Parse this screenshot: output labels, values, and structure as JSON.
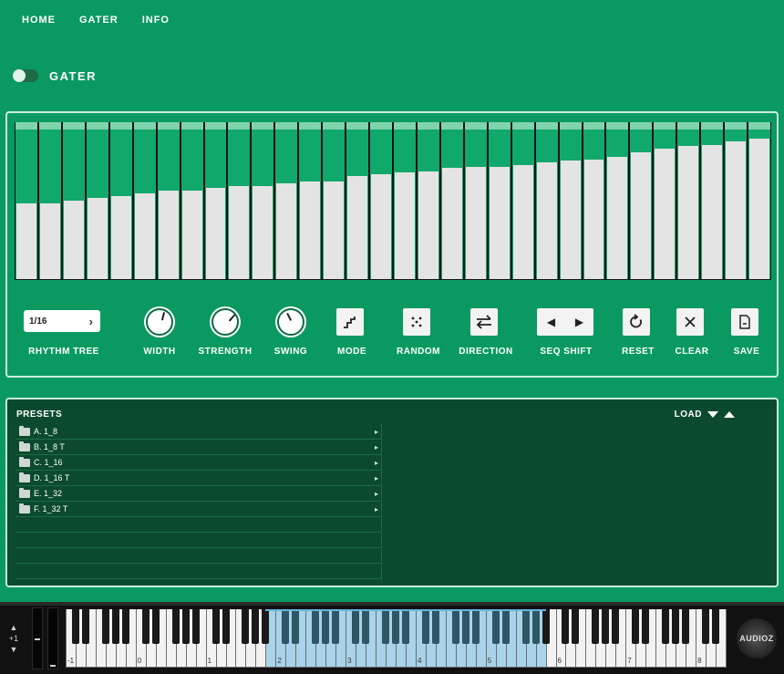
{
  "nav": [
    "HOME",
    "GATER",
    "INFO"
  ],
  "module": {
    "title": "GATER",
    "enabled": false
  },
  "sequencer": {
    "step_levels": [
      0.51,
      0.51,
      0.53,
      0.55,
      0.56,
      0.58,
      0.6,
      0.6,
      0.62,
      0.63,
      0.63,
      0.65,
      0.66,
      0.66,
      0.7,
      0.71,
      0.72,
      0.73,
      0.75,
      0.76,
      0.76,
      0.77,
      0.79,
      0.8,
      0.81,
      0.83,
      0.86,
      0.88,
      0.9,
      0.91,
      0.93,
      0.95
    ]
  },
  "controls": {
    "rhythm_tree": {
      "value": "1/16",
      "label": "RHYTHM TREE"
    },
    "width": {
      "label": "WIDTH",
      "value": 0.55
    },
    "strength": {
      "label": "STRENGTH",
      "value": 0.65
    },
    "swing": {
      "label": "SWING",
      "value": 0.4
    },
    "mode": {
      "label": "MODE",
      "icon": "staircase-icon"
    },
    "random": {
      "label": "RANDOM",
      "icon": "dice-icon"
    },
    "direction": {
      "label": "DIRECTION",
      "icon": "swap-arrows-icon"
    },
    "seq_shift": {
      "label": "SEQ SHIFT",
      "icon_left": "arrow-left-icon",
      "icon_right": "arrow-right-icon"
    },
    "reset": {
      "label": "RESET",
      "icon": "refresh-icon"
    },
    "clear": {
      "label": "CLEAR",
      "icon": "close-icon"
    },
    "save": {
      "label": "SAVE",
      "icon": "save-file-icon"
    }
  },
  "presets": {
    "title": "PRESETS",
    "load_label": "LOAD",
    "items": [
      "A. 1_8",
      "B. 1_8 T",
      "C. 1_16",
      "D. 1_16 T",
      "E. 1_32",
      "F. 1_32 T"
    ]
  },
  "footer": {
    "octave_shift": "+1",
    "octave_labels": [
      "-1",
      "0",
      "1",
      "2",
      "3",
      "4",
      "5",
      "6",
      "7",
      "8"
    ],
    "logo": "AUDIOZ"
  },
  "colors": {
    "background": "#0a9a61",
    "panel_border": "#c9f0da",
    "presets_bg": "#0b4a2e",
    "keyboard_highlight": "#a9d3e8"
  }
}
